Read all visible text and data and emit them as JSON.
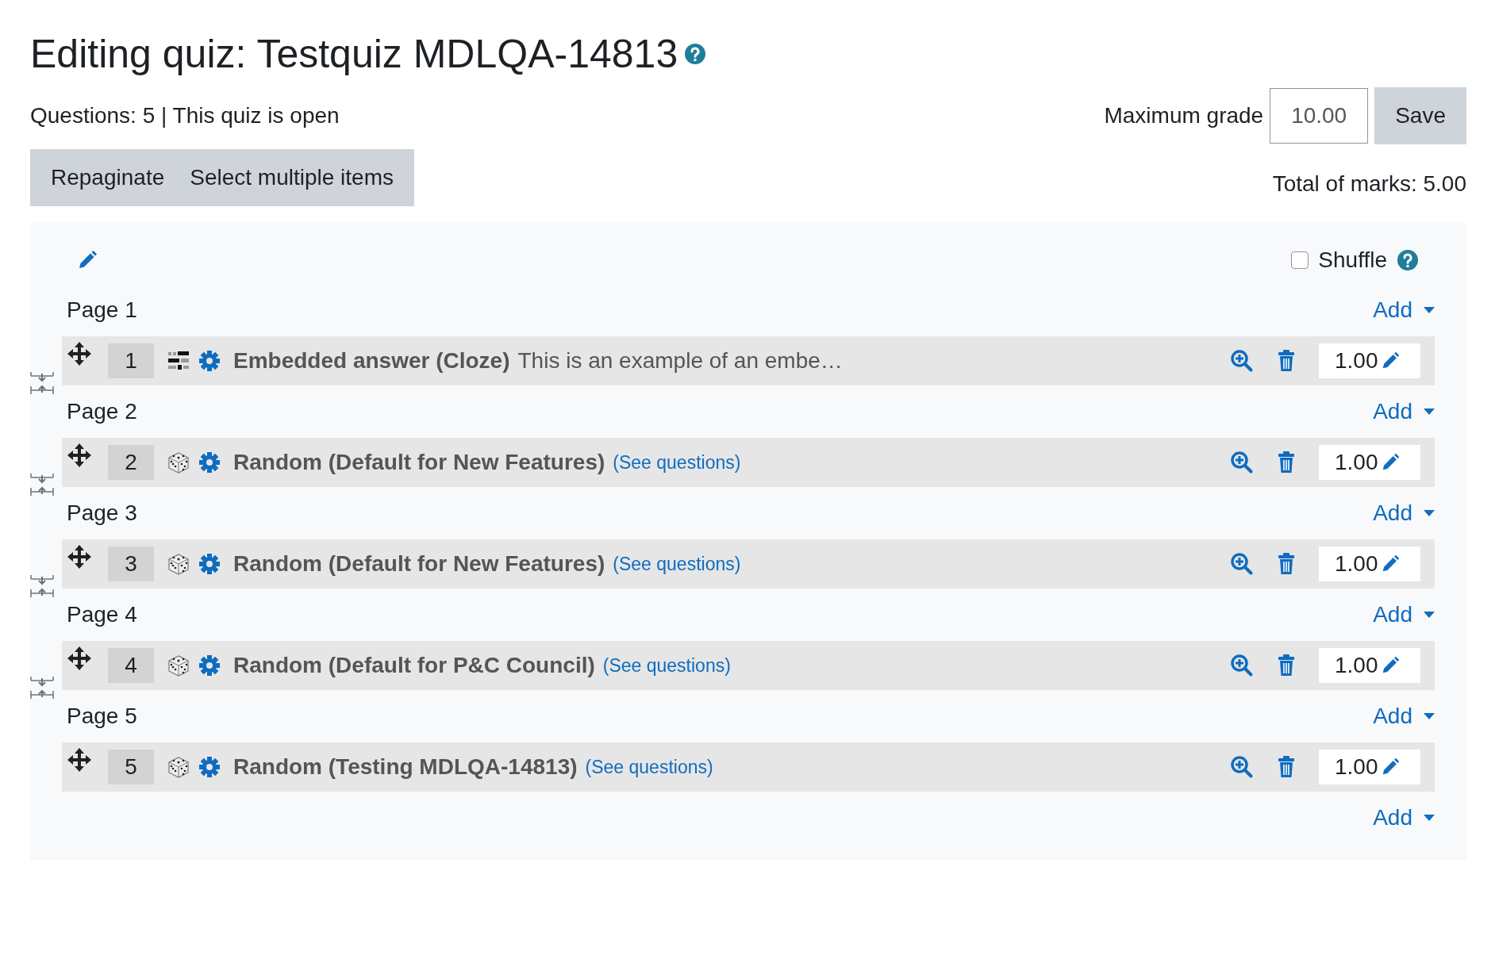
{
  "title": "Editing quiz: Testquiz MDLQA-14813",
  "info": "Questions: 5 | This quiz is open",
  "max_grade": {
    "label": "Maximum grade",
    "value": "10.00",
    "button": "Save"
  },
  "toolbar": [
    "Repaginate",
    "Select multiple items"
  ],
  "total": "Total of marks: 5.00",
  "shuffle": {
    "label": "Shuffle",
    "checked": false
  },
  "pages": [
    {
      "label": "Page 1",
      "add": "Add",
      "questions": [
        {
          "kind": "cloze",
          "number": "1",
          "name": "Embedded answer (Cloze)",
          "summary": "This is an example of an embe…",
          "mark": "1.00"
        }
      ]
    },
    {
      "label": "Page 2",
      "add": "Add",
      "questions": [
        {
          "kind": "random",
          "number": "2",
          "name": "Random (Default for New Features)",
          "link": "(See questions)",
          "mark": "1.00"
        }
      ]
    },
    {
      "label": "Page 3",
      "add": "Add",
      "questions": [
        {
          "kind": "random",
          "number": "3",
          "name": "Random (Default for New Features)",
          "link": "(See questions)",
          "mark": "1.00"
        }
      ]
    },
    {
      "label": "Page 4",
      "add": "Add",
      "questions": [
        {
          "kind": "random",
          "number": "4",
          "name": "Random (Default for P&C Council)",
          "link": "(See questions)",
          "mark": "1.00"
        }
      ]
    },
    {
      "label": "Page 5",
      "add": "Add",
      "questions": [
        {
          "kind": "random",
          "number": "5",
          "name": "Random (Testing MDLQA-14813)",
          "link": "(See questions)",
          "mark": "1.00"
        }
      ]
    }
  ],
  "end_add": "Add"
}
